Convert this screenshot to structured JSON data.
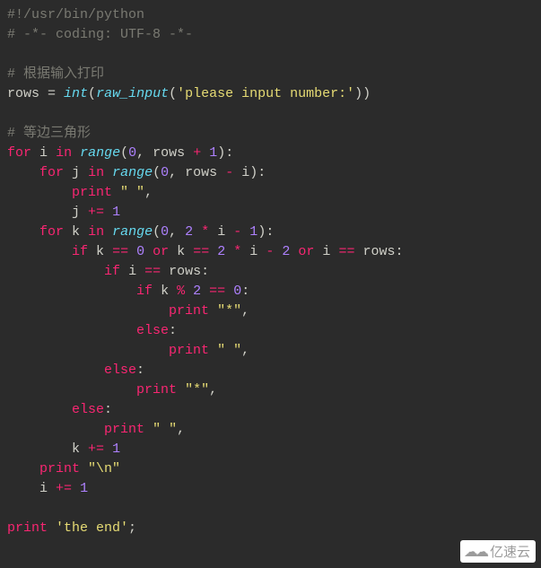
{
  "code": {
    "l01": {
      "shebang": "#!/usr/bin/python"
    },
    "l02": {
      "coding": "# -*- coding: UTF-8 -*-"
    },
    "l04": {
      "comment": "# 根据输入打印"
    },
    "l05": {
      "rows": "rows",
      "eq": " = ",
      "int": "int",
      "lp": "(",
      "raw_input": "raw_input",
      "lp2": "(",
      "str": "'please input number:'",
      "rp2": ")",
      "rp": ")"
    },
    "l07": {
      "comment": "# 等边三角形"
    },
    "l08": {
      "for": "for",
      "sp1": " ",
      "i": "i",
      "sp2": " ",
      "in": "in",
      "sp3": " ",
      "range": "range",
      "lp": "(",
      "z": "0",
      "c1": ", ",
      "rows": "rows",
      "sp4": " ",
      "plus": "+",
      "sp5": " ",
      "one": "1",
      "rp": ")",
      "colon": ":"
    },
    "l09": {
      "indent": "    ",
      "for": "for",
      "sp1": " ",
      "j": "j",
      "sp2": " ",
      "in": "in",
      "sp3": " ",
      "range": "range",
      "lp": "(",
      "z": "0",
      "c1": ", ",
      "rows": "rows",
      "sp4": " ",
      "minus": "-",
      "sp5": " ",
      "i": "i",
      "rp": ")",
      "colon": ":"
    },
    "l10": {
      "indent": "        ",
      "print": "print",
      "sp": " ",
      "str": "\" \"",
      "comma": ","
    },
    "l11": {
      "indent": "        ",
      "j": "j",
      "sp1": " ",
      "op": "+=",
      "sp2": " ",
      "one": "1"
    },
    "l12": {
      "indent": "    ",
      "for": "for",
      "sp1": " ",
      "k": "k",
      "sp2": " ",
      "in": "in",
      "sp3": " ",
      "range": "range",
      "lp": "(",
      "z": "0",
      "c1": ", ",
      "two": "2",
      "sp4": " ",
      "mul": "*",
      "sp5": " ",
      "i": "i",
      "sp6": " ",
      "minus": "-",
      "sp7": " ",
      "one": "1",
      "rp": ")",
      "colon": ":"
    },
    "l13": {
      "indent": "        ",
      "if": "if",
      "sp1": " ",
      "k1": "k",
      "sp2": " ",
      "eq1": "==",
      "sp3": " ",
      "z": "0",
      "sp4": " ",
      "or1": "or",
      "sp5": " ",
      "k2": "k",
      "sp6": " ",
      "eq2": "==",
      "sp7": " ",
      "two": "2",
      "sp8": " ",
      "mul": "*",
      "sp9": " ",
      "i1": "i",
      "sp10": " ",
      "minus": "-",
      "sp11": " ",
      "two2": "2",
      "sp12": " ",
      "or2": "or",
      "sp13": " ",
      "i2": "i",
      "sp14": " ",
      "eq3": "==",
      "sp15": " ",
      "rows": "rows",
      "colon": ":"
    },
    "l14": {
      "indent": "            ",
      "if": "if",
      "sp1": " ",
      "i": "i",
      "sp2": " ",
      "eq": "==",
      "sp3": " ",
      "rows": "rows",
      "colon": ":"
    },
    "l15": {
      "indent": "                ",
      "if": "if",
      "sp1": " ",
      "k": "k",
      "sp2": " ",
      "mod": "%",
      "sp3": " ",
      "two": "2",
      "sp4": " ",
      "eq": "==",
      "sp5": " ",
      "z": "0",
      "colon": ":"
    },
    "l16": {
      "indent": "                    ",
      "print": "print",
      "sp": " ",
      "str": "\"*\"",
      "comma": ","
    },
    "l17": {
      "indent": "                ",
      "else": "else",
      "colon": ":"
    },
    "l18": {
      "indent": "                    ",
      "print": "print",
      "sp": " ",
      "str": "\" \"",
      "comma": ","
    },
    "l19": {
      "indent": "            ",
      "else": "else",
      "colon": ":"
    },
    "l20": {
      "indent": "                ",
      "print": "print",
      "sp": " ",
      "str": "\"*\"",
      "comma": ","
    },
    "l21": {
      "indent": "        ",
      "else": "else",
      "colon": ":"
    },
    "l22": {
      "indent": "            ",
      "print": "print",
      "sp": " ",
      "str": "\" \"",
      "comma": ","
    },
    "l23": {
      "indent": "        ",
      "k": "k",
      "sp1": " ",
      "op": "+=",
      "sp2": " ",
      "one": "1"
    },
    "l24": {
      "indent": "    ",
      "print": "print",
      "sp": " ",
      "str": "\"\\n\""
    },
    "l25": {
      "indent": "    ",
      "i": "i",
      "sp1": " ",
      "op": "+=",
      "sp2": " ",
      "one": "1"
    },
    "l27": {
      "print": "print",
      "sp": " ",
      "str": "'the end'",
      "semi": ";"
    }
  },
  "watermark": {
    "text": "亿速云"
  }
}
